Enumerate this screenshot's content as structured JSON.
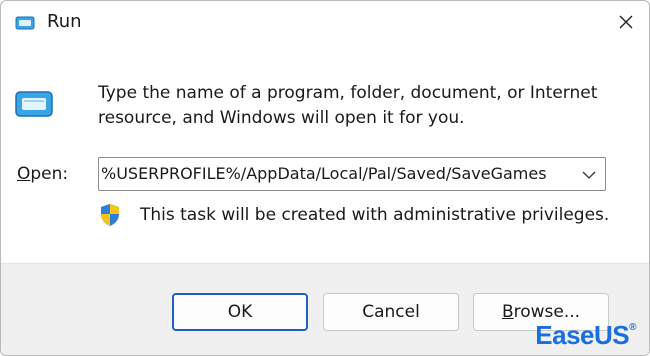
{
  "window": {
    "title": "Run",
    "app_icon": "run-icon",
    "close_icon": "close-icon"
  },
  "body": {
    "description_line1": "Type the name of a program, folder, document, or Internet",
    "description_line2": "resource, and Windows will open it for you.",
    "open_label_accel": "O",
    "open_label_rest": "pen:",
    "open_value": "%USERPROFILE%/AppData/Local/Pal/Saved/SaveGames",
    "admin_note": "This task will be created with administrative privileges."
  },
  "buttons": {
    "ok": "OK",
    "cancel": "Cancel",
    "browse_accel": "B",
    "browse_rest": "rowse..."
  },
  "watermark": {
    "brand": "EaseUS",
    "reg": "®"
  },
  "colors": {
    "accent": "#1f5fbf",
    "logo": "#1a6ee0",
    "shield_blue": "#2f7ed8",
    "shield_yellow": "#f5c518"
  }
}
